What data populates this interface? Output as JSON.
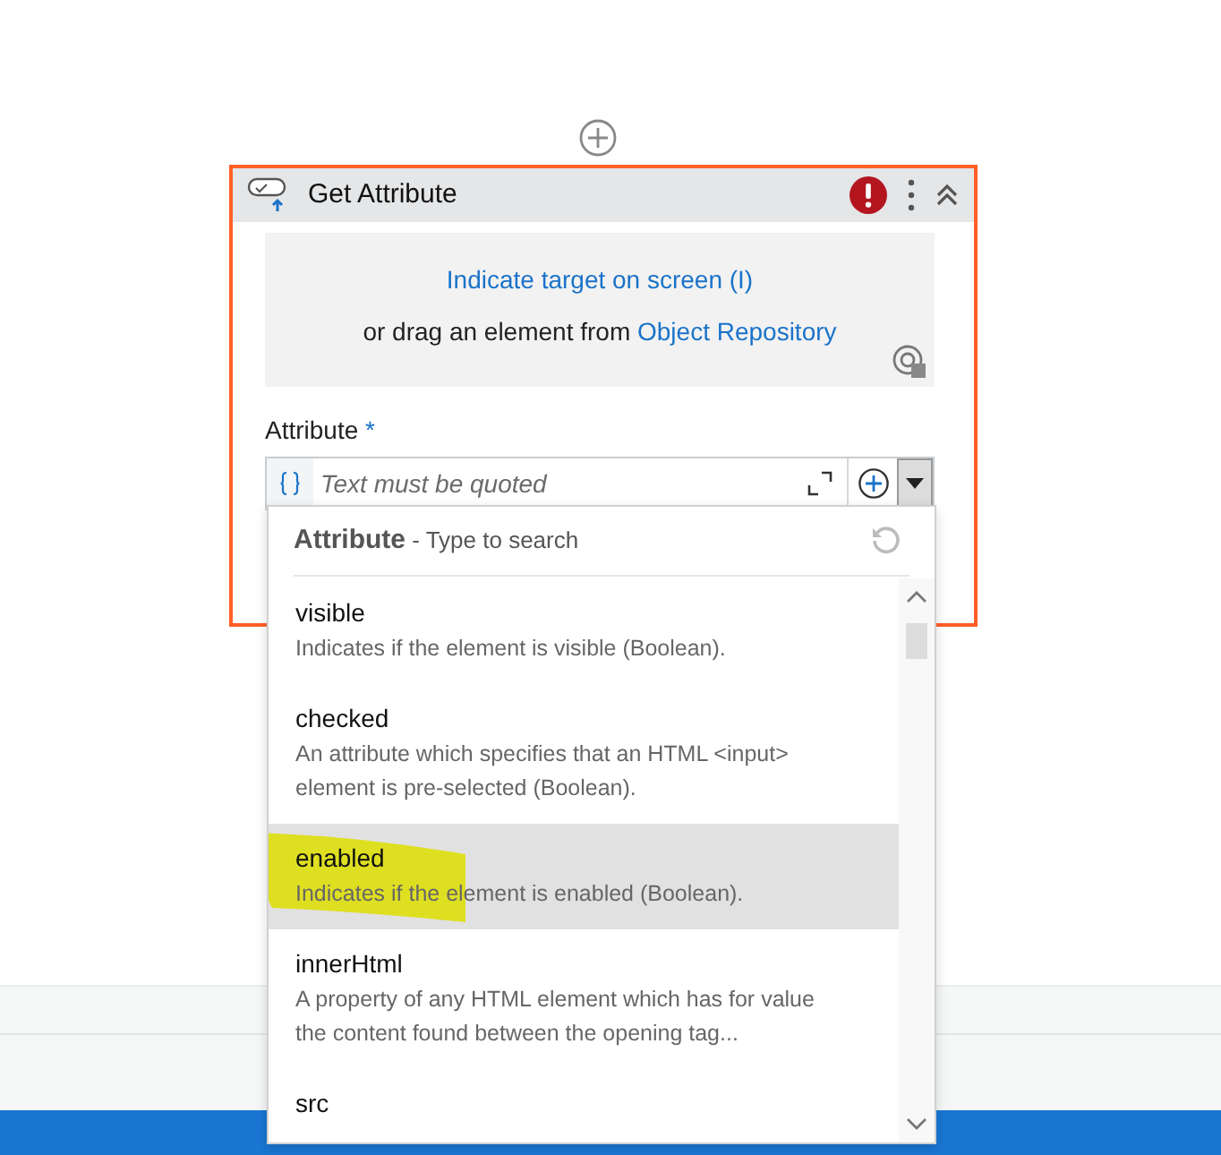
{
  "card": {
    "title": "Get Attribute",
    "error": true,
    "target": {
      "indicate_link": "Indicate target on screen (I)",
      "drag_text": "or drag an element from",
      "repository_link": "Object Repository"
    },
    "field": {
      "label": "Attribute",
      "required_mark": "*",
      "placeholder": "Text must be quoted"
    }
  },
  "dropdown": {
    "header": "**Attribute** - Type to search",
    "items": [
      {
        "name": "visible",
        "description": "Indicates if the element is visible (Boolean).",
        "selected": false
      },
      {
        "name": "checked",
        "description": "An attribute which specifies that an HTML  <input> element is pre-selected (Boolean).",
        "selected": false
      },
      {
        "name": "enabled",
        "description": "Indicates if the element is enabled (Boolean).",
        "selected": true
      },
      {
        "name": "innerHtml",
        "description": "A property of any HTML element which has for value the content found between the opening tag...",
        "selected": false
      },
      {
        "name": "src",
        "selected": false
      }
    ]
  }
}
